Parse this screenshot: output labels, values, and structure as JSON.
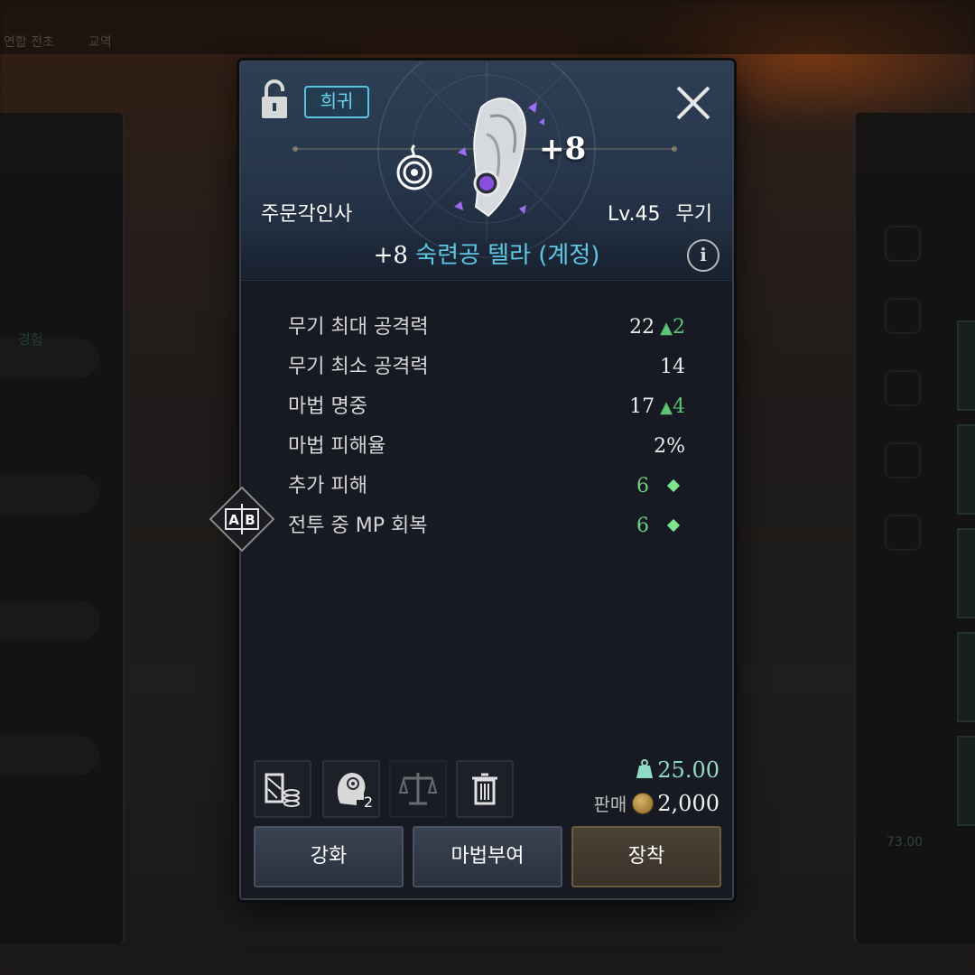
{
  "background": {
    "top_hints": [
      "연합 전초",
      "교역"
    ],
    "left_hint": "경험",
    "right_weight": "73.00"
  },
  "item": {
    "rarity": "희귀",
    "enhance": "+8",
    "class_name": "주문각인사",
    "level": "Lv.45",
    "type": "무기",
    "name_prefix": "+8",
    "name": "숙련공 텔라 (계정)",
    "info_symbol": "i"
  },
  "stats": [
    {
      "label": "무기 최대 공격력",
      "value": "22",
      "delta": "2"
    },
    {
      "label": "무기 최소 공격력",
      "value": "14"
    },
    {
      "label": "마법 명중",
      "value": "17",
      "delta": "4"
    },
    {
      "label": "마법 피해율",
      "value": "2%"
    },
    {
      "label": "추가 피해",
      "value": "6",
      "bonus": true
    },
    {
      "label": "전투 중 MP 회복",
      "value": "6",
      "bonus": true
    }
  ],
  "ab_toggle_label": "A|B",
  "tools": {
    "mastery_count": "2"
  },
  "weight": "25.00",
  "sell": {
    "label": "판매",
    "price": "2,000"
  },
  "actions": {
    "enhance": "강화",
    "enchant": "마법부여",
    "equip": "장착"
  },
  "colors": {
    "rarity": "#58c6e0",
    "item_name": "#5fc7e6",
    "stat_up": "#5cc274",
    "weight": "#8fdcc4"
  }
}
